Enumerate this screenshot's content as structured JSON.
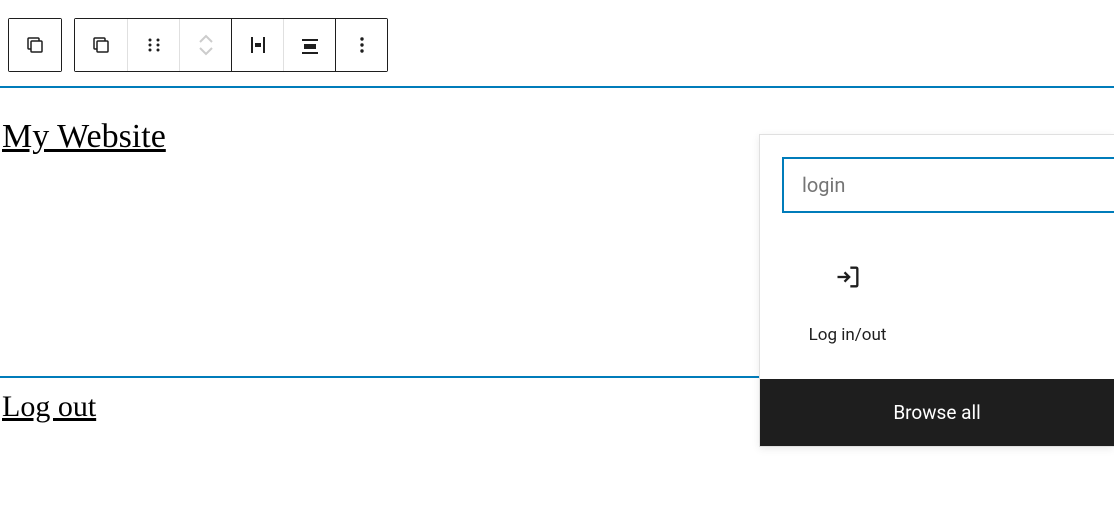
{
  "site": {
    "title": "My Website",
    "logout_label": "Log out"
  },
  "inserter": {
    "search_value": "login",
    "block_label": "Log in/out",
    "browse_all_label": "Browse all"
  }
}
